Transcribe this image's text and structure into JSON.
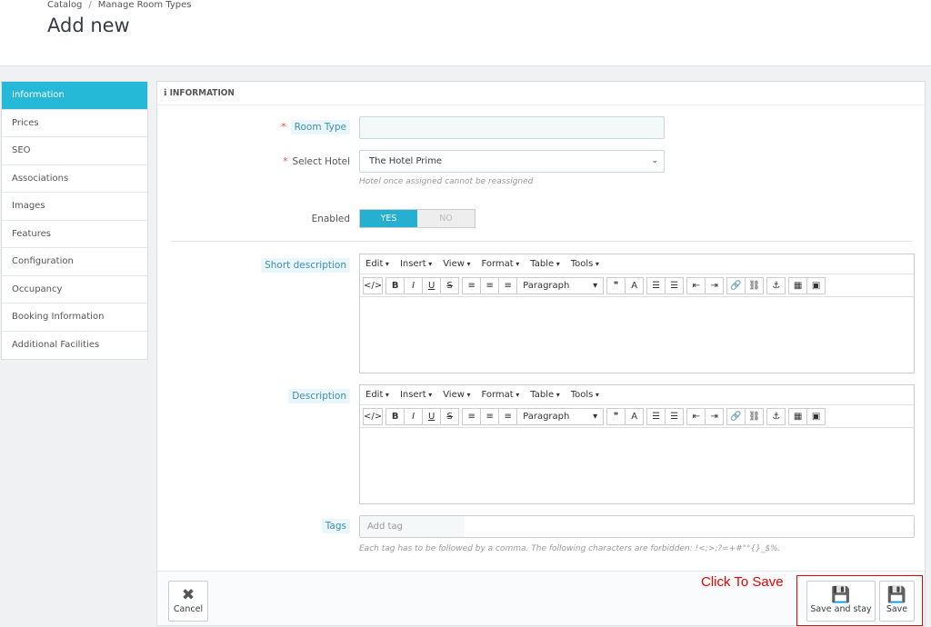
{
  "breadcrumb": {
    "items": [
      "Catalog",
      "Manage Room Types"
    ]
  },
  "page_title": "Add new",
  "sidebar": {
    "items": [
      {
        "label": "Information",
        "active": true
      },
      {
        "label": "Prices"
      },
      {
        "label": "SEO"
      },
      {
        "label": "Associations"
      },
      {
        "label": "Images"
      },
      {
        "label": "Features"
      },
      {
        "label": "Configuration"
      },
      {
        "label": "Occupancy"
      },
      {
        "label": "Booking Information"
      },
      {
        "label": "Additional Facilities"
      }
    ]
  },
  "panel": {
    "title": "INFORMATION",
    "icon": "info-icon"
  },
  "form": {
    "room_type": {
      "label": "Room Type",
      "value": "",
      "required": true
    },
    "hotel": {
      "label": "Select Hotel",
      "value": "The Hotel Prime",
      "help": "Hotel once assigned cannot be reassigned",
      "required": true
    },
    "enabled": {
      "label": "Enabled",
      "yes": "YES",
      "no": "NO",
      "value": "YES"
    },
    "short_description": {
      "label": "Short description"
    },
    "description": {
      "label": "Description"
    },
    "tags": {
      "label": "Tags",
      "placeholder": "Add tag",
      "help": "Each tag has to be followed by a comma. The following characters are forbidden: !<;>;?=+#\"°{}_$%."
    }
  },
  "editor": {
    "menu": [
      "Edit",
      "Insert",
      "View",
      "Format",
      "Table",
      "Tools"
    ],
    "format_value": "Paragraph",
    "buttons": [
      [
        "source-code",
        "</>"
      ],
      [
        "bold",
        "B"
      ],
      [
        "italic",
        "I"
      ],
      [
        "underline",
        "U"
      ],
      [
        "strikethrough",
        "S"
      ],
      [
        "align-left",
        "≡"
      ],
      [
        "align-center",
        "≡"
      ],
      [
        "align-right",
        "≡"
      ]
    ],
    "buttons2": [
      [
        "blockquote",
        "❞"
      ],
      [
        "text-color",
        "A"
      ],
      [
        "bullet-list",
        "☰"
      ],
      [
        "numbered-list",
        "☰"
      ],
      [
        "outdent",
        "⇤"
      ],
      [
        "indent",
        "⇥"
      ],
      [
        "link",
        "🔗"
      ],
      [
        "unlink",
        "⛓"
      ],
      [
        "anchor",
        "⚓"
      ],
      [
        "media",
        "▦"
      ],
      [
        "image",
        "▣"
      ]
    ]
  },
  "footer": {
    "cancel": "Cancel",
    "save_and_stay": "Save and stay",
    "save": "Save"
  },
  "annotation": {
    "text": "Click To Save",
    "color": "#e00000"
  },
  "colors": {
    "accent": "#25b9d7"
  }
}
